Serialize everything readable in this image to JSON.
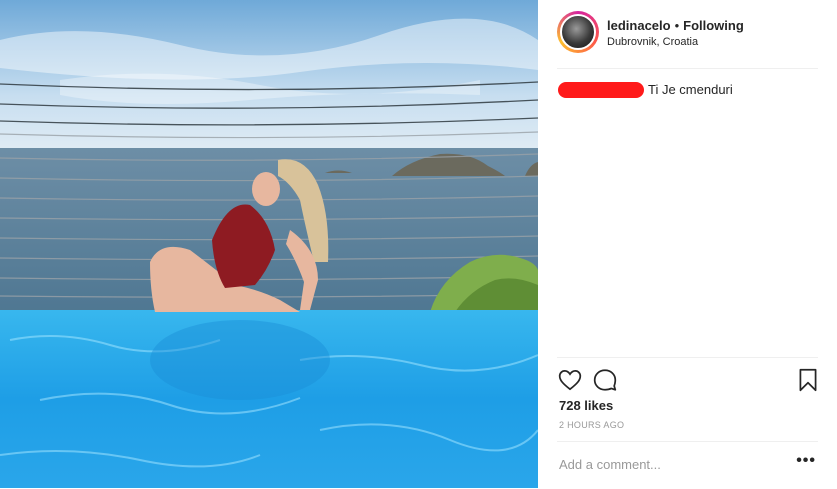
{
  "post": {
    "username": "ledinacelo",
    "separator": "•",
    "follow_status": "Following",
    "location": "Dubrovnik, Croatia",
    "comment": {
      "author_redacted": true,
      "text": "Ti Je cmenduri"
    },
    "likes": "728 likes",
    "timestamp": "2 HOURS AGO",
    "add_comment_placeholder": "Add a comment...",
    "more_label": "•••"
  },
  "icons": {
    "like": "heart-outline-icon",
    "comment": "speech-bubble-icon",
    "save": "bookmark-icon",
    "more": "more-options-icon"
  },
  "colors": {
    "redaction": "#ff1a1a",
    "avatar_ring": "#d6249f",
    "muted_text": "#999999",
    "text": "#262626",
    "divider": "#efefef"
  }
}
